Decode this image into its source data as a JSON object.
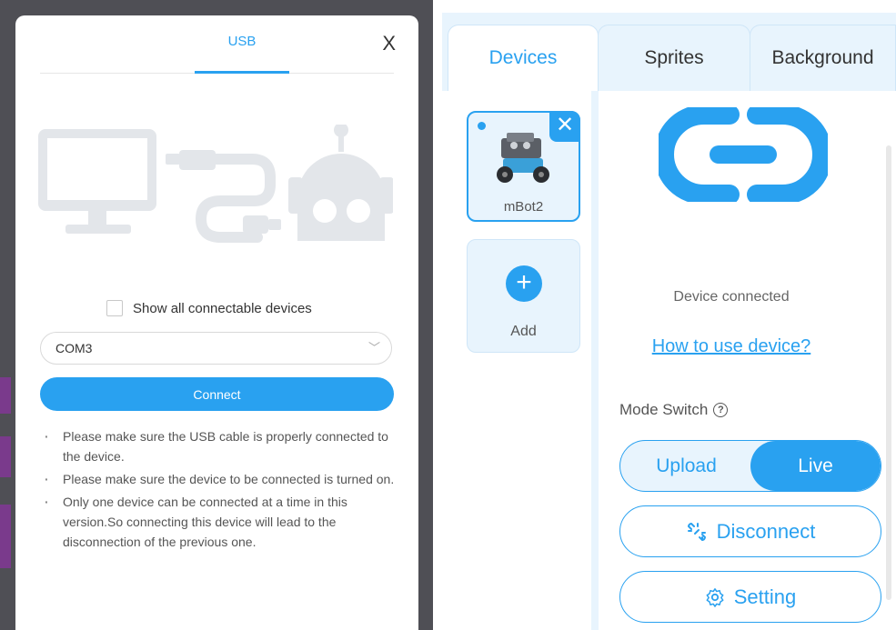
{
  "dialog": {
    "tab_label": "USB",
    "close_glyph": "X",
    "show_all_label": "Show all connectable devices",
    "port_value": "COM3",
    "connect_label": "Connect",
    "tips": [
      "Please make sure the USB cable is properly connected to the device.",
      "Please make sure the device to be connected is turned on.",
      "Only one device can be connected at a time in this version.So connecting this device will lead to the disconnection of the previous one."
    ]
  },
  "panel": {
    "tabs": {
      "devices": "Devices",
      "sprites": "Sprites",
      "background": "Background"
    },
    "device_card": {
      "name": "mBot2",
      "close_glyph": "✕"
    },
    "add_card": {
      "plus_glyph": "+",
      "label": "Add"
    },
    "status_text": "Device connected",
    "howto_link": "How to use device?",
    "mode_switch_label": "Mode Switch",
    "mode_help_glyph": "?",
    "mode_upload": "Upload",
    "mode_live": "Live",
    "disconnect_label": "Disconnect",
    "setting_label": "Setting"
  },
  "colors": {
    "accent": "#29a1f0",
    "light": "#e8f4fd",
    "illustration": "#e3e6ea"
  },
  "icons": [
    "close-icon",
    "computer-illustration",
    "usb-cable-illustration",
    "robot-illustration",
    "link-icon",
    "help-icon",
    "unlink-icon",
    "gear-icon",
    "chevron-down-icon",
    "plus-icon"
  ]
}
